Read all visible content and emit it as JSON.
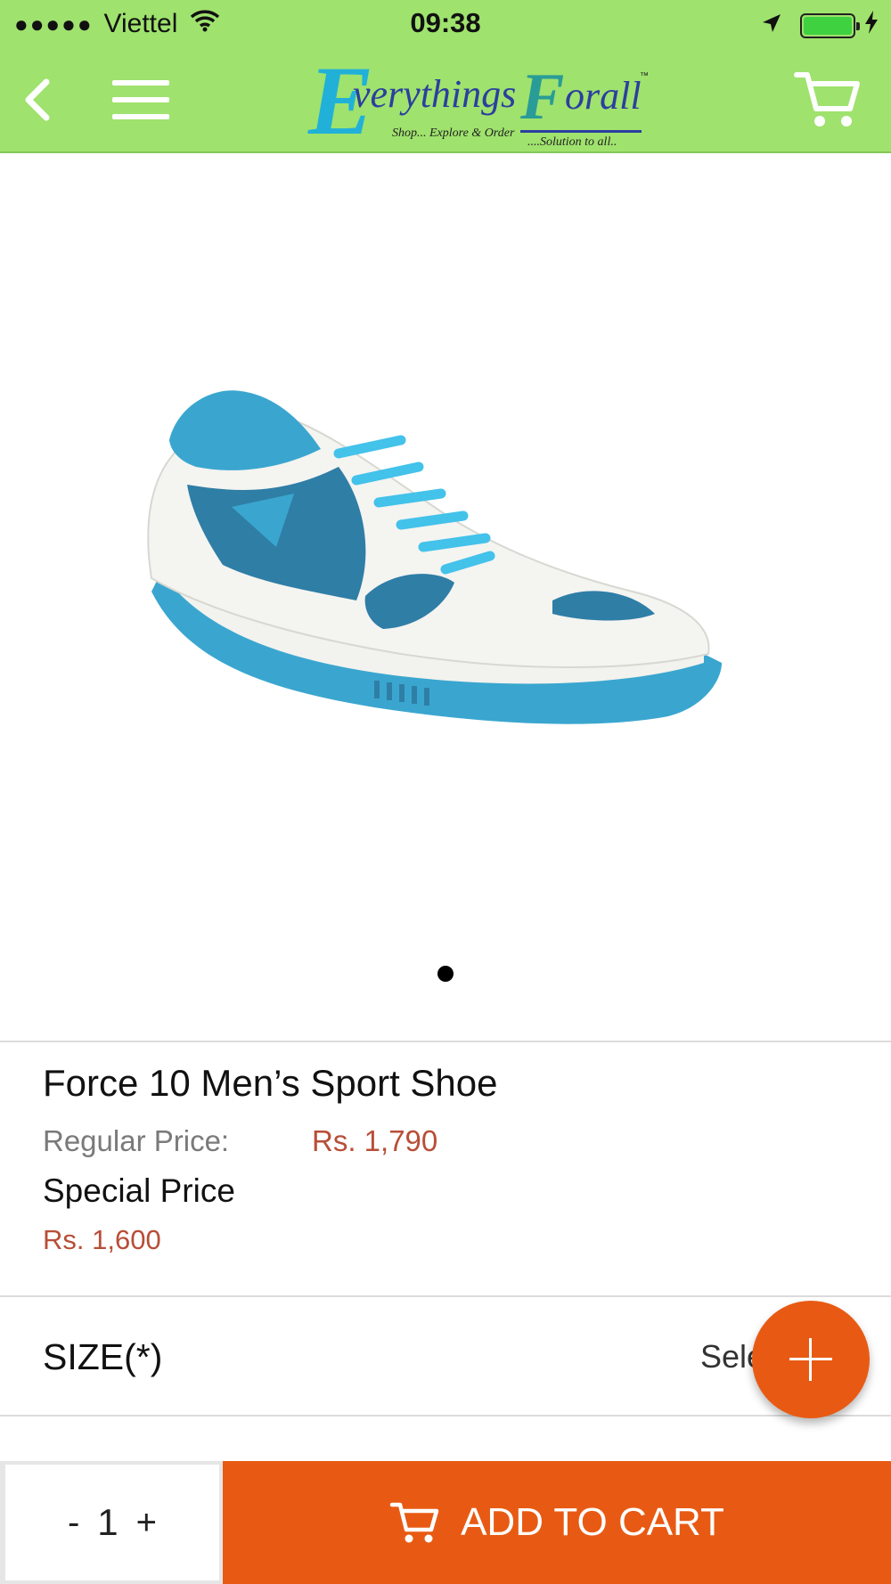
{
  "status_bar": {
    "signal": "●●●●●",
    "carrier": "Viettel",
    "time": "09:38"
  },
  "header": {
    "logo": {
      "line1": "E",
      "word1": "verythings",
      "line2": "F",
      "word2": "orall",
      "tm": "™",
      "tagline1": "Shop... Explore & Order",
      "tagline2": "....Solution to all.."
    }
  },
  "gallery": {
    "image": "shoe-image",
    "page_count": 1,
    "current_page": 1
  },
  "product": {
    "title": "Force 10 Men’s Sport Shoe",
    "regular_price_label": "Regular Price:",
    "regular_price": "Rs.  1,790",
    "special_price_label": "Special Price",
    "special_price": "Rs.  1,600"
  },
  "options": {
    "size_label": "SIZE(*)",
    "size_value": "Select"
  },
  "bottom_bar": {
    "qty_minus": "-",
    "qty_value": "1",
    "qty_plus": "+",
    "add_to_cart": "ADD TO CART"
  },
  "colors": {
    "header_bg": "#9fe26d",
    "accent": "#e85a13",
    "price": "#b84e37"
  }
}
